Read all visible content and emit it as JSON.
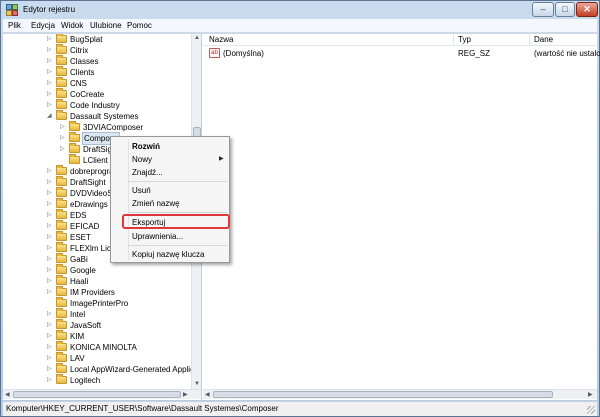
{
  "window": {
    "title": "Edytor rejestru",
    "accent": "#b9d0ea"
  },
  "menubar": {
    "items": [
      "Plik",
      "Edycja",
      "Widok",
      "Ulubione",
      "Pomoc"
    ]
  },
  "tree": {
    "items": [
      {
        "label": "BugSplat"
      },
      {
        "label": "Citrix"
      },
      {
        "label": "Classes"
      },
      {
        "label": "Clients"
      },
      {
        "label": "CNS"
      },
      {
        "label": "CoCreate"
      },
      {
        "label": "Code Industry"
      },
      {
        "label": "Dassault Systemes"
      },
      {
        "label": "3DVIAComposer"
      },
      {
        "label": "Compose"
      },
      {
        "label": "DraftSigh"
      },
      {
        "label": "LClient"
      },
      {
        "label": "dobreprogra"
      },
      {
        "label": "DraftSight"
      },
      {
        "label": "DVDVideoSo"
      },
      {
        "label": "eDrawings"
      },
      {
        "label": "EDS"
      },
      {
        "label": "EFICAD"
      },
      {
        "label": "ESET"
      },
      {
        "label": "FLEXlm Licer"
      },
      {
        "label": "GaBi"
      },
      {
        "label": "Google"
      },
      {
        "label": "Haali"
      },
      {
        "label": "IM Providers"
      },
      {
        "label": "ImagePrinterPro"
      },
      {
        "label": "Intel"
      },
      {
        "label": "JavaSoft"
      },
      {
        "label": "KIM"
      },
      {
        "label": "KONICA MINOLTA"
      },
      {
        "label": "LAV"
      },
      {
        "label": "Local AppWizard-Generated Applicati"
      },
      {
        "label": "Logitech"
      }
    ]
  },
  "list": {
    "columns": [
      "Nazwa",
      "Typ",
      "Dane"
    ],
    "rows": [
      {
        "name": "(Domyślna)",
        "type": "REG_SZ",
        "data": "(wartość nie ustalon",
        "icon": "string-value-icon"
      }
    ]
  },
  "context_menu": {
    "items": [
      "Rozwiń",
      "Nowy",
      "Znajdź...",
      "Usuń",
      "Zmień nazwę",
      "Eksportuj",
      "Uprawnienia...",
      "Kopiuj nazwę klucza"
    ],
    "highlight_color": "#e0373c"
  },
  "statusbar": {
    "path": "Komputer\\HKEY_CURRENT_USER\\Software\\Dassault Systemes\\Composer"
  }
}
